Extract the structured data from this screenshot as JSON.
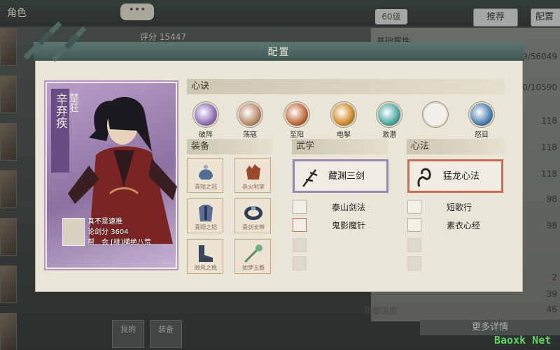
{
  "background": {
    "role_tab": "角色",
    "chat_button": "•••",
    "level": "60级",
    "recommend_button": "推荐",
    "config_button": "配置",
    "score_label": "评分 15447",
    "right_rows": [
      "基础属性",
      "56049/56049",
      "10590/10590",
      "118",
      "118",
      "118",
      "98",
      "98",
      "2",
      "39",
      "46"
    ],
    "stat_labels": [
      "防御强度"
    ],
    "more_details": "更多详情",
    "bottom_buttons": [
      "我的",
      "装备"
    ],
    "watermark": "Baoxk Net"
  },
  "dialog": {
    "title": "配置",
    "character": {
      "name": "辛弃疾",
      "title": "楚狂",
      "info_lines": [
        "真不是速推",
        "论剑分 3604",
        "帮　会 [桃]横绝八荒"
      ]
    },
    "xinjue": {
      "header": "心诀",
      "skills": [
        {
          "label": "破阵",
          "color": "#8e6fb8"
        },
        {
          "label": "荡寇",
          "color": "#b98a6a"
        },
        {
          "label": "至阳",
          "color": "#c06a3a"
        },
        {
          "label": "电掣",
          "color": "#d08a2a"
        },
        {
          "label": "激潜",
          "color": "#4aa8a0"
        },
        {
          "label": "",
          "color": "#f2f0ea"
        },
        {
          "label": "怒目",
          "color": "#4a7fb0"
        }
      ]
    },
    "equipment": {
      "header": "装备",
      "items": [
        {
          "name": "青阳之冠",
          "icon": "helmet-icon"
        },
        {
          "name": "赤火利掌",
          "icon": "glove-icon"
        },
        {
          "name": "青阳之铠",
          "icon": "armor-icon"
        },
        {
          "name": "青剑长带",
          "icon": "belt-icon"
        },
        {
          "name": "颐风之靴",
          "icon": "boot-icon"
        },
        {
          "name": "如梦玉簪",
          "icon": "hairpin-icon"
        }
      ]
    },
    "martial": {
      "header": "武学",
      "main": "藏渊三剑",
      "others": [
        "泰山剑法",
        "鬼影魔针"
      ]
    },
    "mental": {
      "header": "心法",
      "main": "猛龙心法",
      "others": [
        "短歌行",
        "素衣心经"
      ]
    }
  }
}
